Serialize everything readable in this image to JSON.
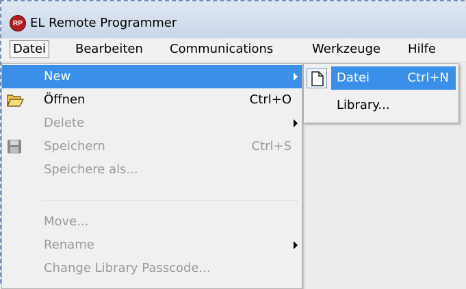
{
  "window": {
    "title": "EL Remote Programmer",
    "icon": "rp-app-icon",
    "icon_text": "RP"
  },
  "menubar": {
    "items": [
      {
        "label": "Datei"
      },
      {
        "label": "Bearbeiten"
      },
      {
        "label": "Communications"
      },
      {
        "label": "Werkzeuge"
      },
      {
        "label": "Hilfe"
      }
    ],
    "open_item": "Datei"
  },
  "datei_menu": {
    "items": [
      {
        "label": "New",
        "shortcut": "",
        "submenu": true,
        "state": "highlighted",
        "icon": ""
      },
      {
        "label": "Öffnen",
        "shortcut": "Ctrl+O",
        "submenu": false,
        "state": "enabled",
        "icon": "open-folder-icon"
      },
      {
        "label": "Delete",
        "shortcut": "",
        "submenu": true,
        "state": "disabled",
        "icon": ""
      },
      {
        "label": "Speichern",
        "shortcut": "Ctrl+S",
        "submenu": false,
        "state": "disabled",
        "icon": "save-disk-icon"
      },
      {
        "label": "Speichere als...",
        "shortcut": "",
        "submenu": false,
        "state": "disabled",
        "icon": ""
      },
      {
        "label": "Move...",
        "shortcut": "",
        "submenu": false,
        "state": "disabled",
        "icon": ""
      },
      {
        "label": "Rename",
        "shortcut": "",
        "submenu": true,
        "state": "disabled",
        "icon": ""
      },
      {
        "label": "Change Library Passcode...",
        "shortcut": "",
        "submenu": false,
        "state": "disabled",
        "icon": ""
      }
    ]
  },
  "new_submenu": {
    "items": [
      {
        "label": "Datei",
        "shortcut": "Ctrl+N",
        "state": "highlighted",
        "icon": "new-document-icon"
      },
      {
        "label": "Library...",
        "shortcut": "",
        "state": "enabled",
        "icon": ""
      }
    ]
  },
  "colors": {
    "highlight": "#3a8fe8",
    "disabled_text": "#9a9a9a",
    "menu_bg": "#f0f0f0"
  }
}
